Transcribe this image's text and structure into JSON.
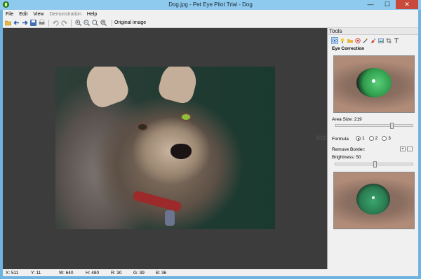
{
  "window": {
    "title": "Dog.jpg - Pet Eye Pilot Trial - Dog",
    "minimize_glyph": "—",
    "maximize_glyph": "☐",
    "close_glyph": "✕"
  },
  "menu": {
    "items": [
      "File",
      "Edit",
      "View",
      "Demonstration",
      "Help"
    ]
  },
  "toolbar": {
    "original_image_label": "Original image"
  },
  "watermark": "SOF",
  "tools": {
    "header": "Tools",
    "section_title": "Eye Correction",
    "area_size_label": "Area Size: 219",
    "area_size_value": 219,
    "formula_label": "Formula",
    "formula_options": [
      "1",
      "2",
      "3"
    ],
    "formula_selected": "1",
    "remove_border_label": "Remove Border:",
    "remove_border_add": "+",
    "remove_border_remove": "-",
    "brightness_label": "Brightness: 50",
    "brightness_value": 50
  },
  "status": {
    "x": "X: 511",
    "y": "Y: 11",
    "w": "W: 640",
    "h": "H: 480",
    "r": "R: 30",
    "g": "G: 39",
    "b": "B: 36"
  }
}
